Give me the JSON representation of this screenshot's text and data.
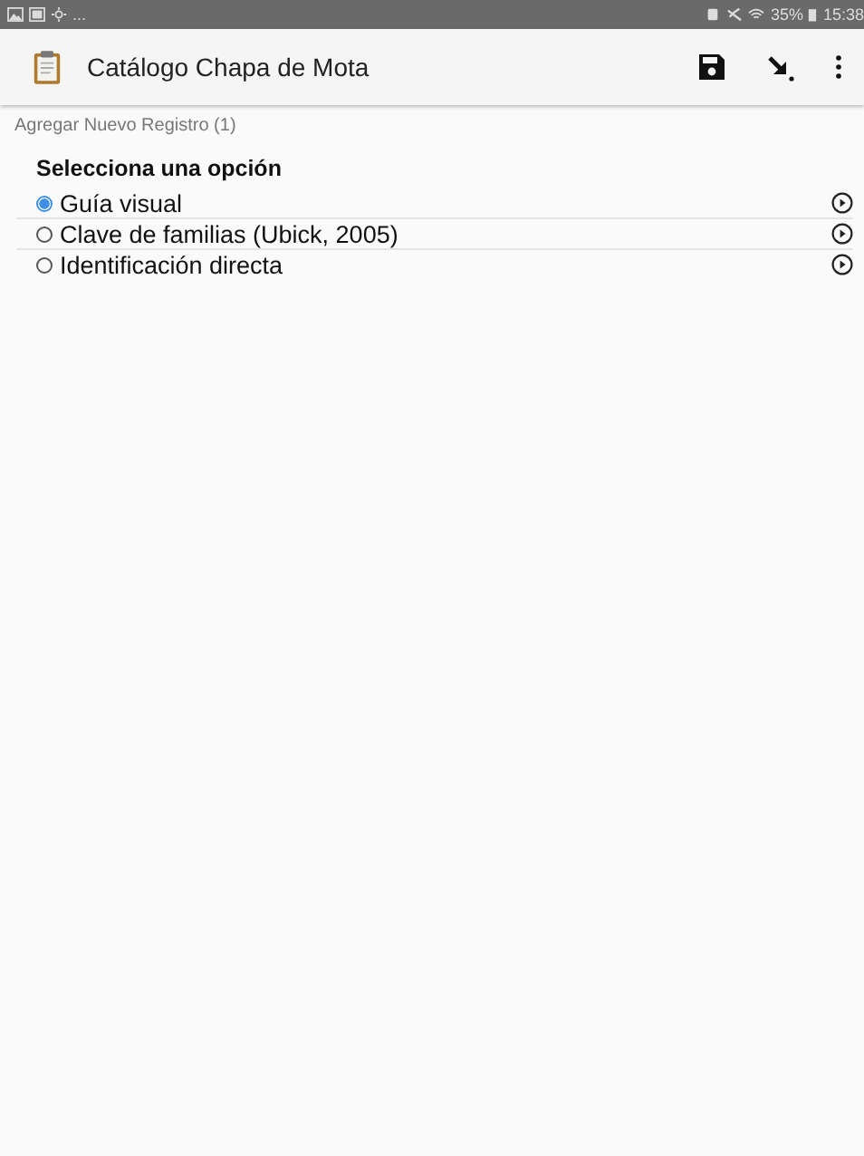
{
  "status_bar": {
    "left_text": "...",
    "battery": "35%",
    "time": "15:38"
  },
  "app_bar": {
    "title": "Catálogo Chapa de Mota"
  },
  "subtitle": "Agregar Nuevo Registro (1)",
  "question": "Selecciona una opción",
  "options": [
    {
      "label": "Guía visual",
      "selected": true
    },
    {
      "label": "Clave de familias (Ubick, 2005)",
      "selected": false
    },
    {
      "label": "Identificación directa",
      "selected": false
    }
  ]
}
